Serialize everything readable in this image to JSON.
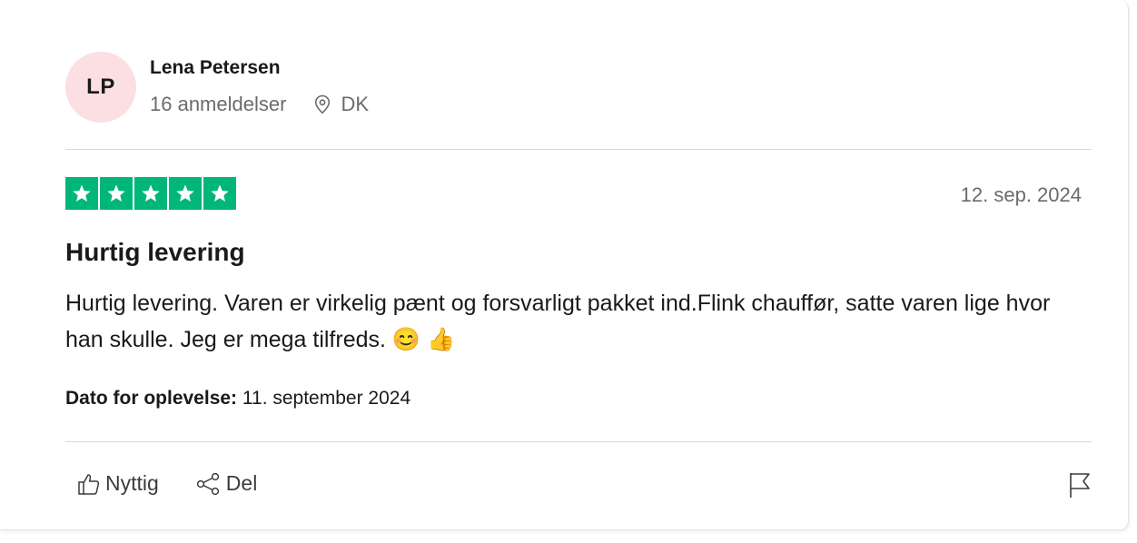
{
  "reviewer": {
    "initials": "LP",
    "name": "Lena Petersen",
    "review_count": "16 anmeldelser",
    "country": "DK",
    "avatar_color": "#fbdfe3"
  },
  "review": {
    "rating": 5,
    "rating_max": 5,
    "star_color": "#00b67a",
    "date": "12. sep. 2024",
    "title": "Hurtig levering",
    "text": "Hurtig levering. Varen er virkelig pænt og forsvarligt pakket ind.Flink chauffør, satte varen lige hvor han skulle. Jeg er mega tilfreds. 😊 👍",
    "experience_label": "Dato for oplevelse:",
    "experience_date": "11. september 2024"
  },
  "actions": {
    "useful_label": "Nyttig",
    "share_label": "Del",
    "icons": [
      "thumbs-up-icon",
      "share-icon",
      "flag-icon"
    ]
  }
}
